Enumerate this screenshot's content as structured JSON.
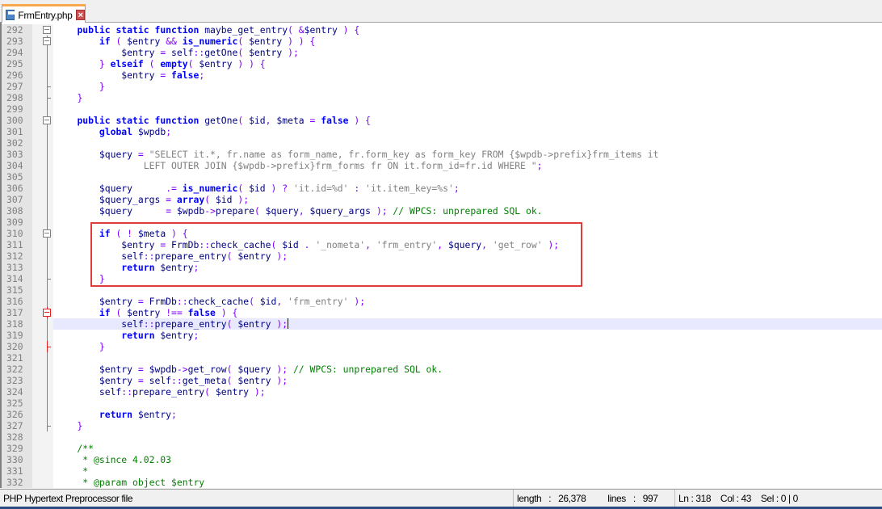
{
  "tab": {
    "filename": "FrmEntry.php",
    "close_icon": "close-icon",
    "file_icon": "save-icon"
  },
  "editor": {
    "current_line": 318,
    "lines": [
      {
        "n": 292,
        "text": "    public static function maybe_get_entry( &$entry ) {"
      },
      {
        "n": 293,
        "text": "        if ( $entry && is_numeric( $entry ) ) {"
      },
      {
        "n": 294,
        "text": "            $entry = self::getOne( $entry );"
      },
      {
        "n": 295,
        "text": "        } elseif ( empty( $entry ) ) {"
      },
      {
        "n": 296,
        "text": "            $entry = false;"
      },
      {
        "n": 297,
        "text": "        }"
      },
      {
        "n": 298,
        "text": "    }"
      },
      {
        "n": 299,
        "text": ""
      },
      {
        "n": 300,
        "text": "    public static function getOne( $id, $meta = false ) {"
      },
      {
        "n": 301,
        "text": "        global $wpdb;"
      },
      {
        "n": 302,
        "text": ""
      },
      {
        "n": 303,
        "text": "        $query = \"SELECT it.*, fr.name as form_name, fr.form_key as form_key FROM {$wpdb->prefix}frm_items it"
      },
      {
        "n": 304,
        "text": "                LEFT OUTER JOIN {$wpdb->prefix}frm_forms fr ON it.form_id=fr.id WHERE \";"
      },
      {
        "n": 305,
        "text": ""
      },
      {
        "n": 306,
        "text": "        $query      .= is_numeric( $id ) ? 'it.id=%d' : 'it.item_key=%s';"
      },
      {
        "n": 307,
        "text": "        $query_args = array( $id );"
      },
      {
        "n": 308,
        "text": "        $query      = $wpdb->prepare( $query, $query_args ); // WPCS: unprepared SQL ok."
      },
      {
        "n": 309,
        "text": ""
      },
      {
        "n": 310,
        "text": "        if ( ! $meta ) {"
      },
      {
        "n": 311,
        "text": "            $entry = FrmDb::check_cache( $id . '_nometa', 'frm_entry', $query, 'get_row' );"
      },
      {
        "n": 312,
        "text": "            self::prepare_entry( $entry );"
      },
      {
        "n": 313,
        "text": "            return $entry;"
      },
      {
        "n": 314,
        "text": "        }"
      },
      {
        "n": 315,
        "text": ""
      },
      {
        "n": 316,
        "text": "        $entry = FrmDb::check_cache( $id, 'frm_entry' );"
      },
      {
        "n": 317,
        "text": "        if ( $entry !== false ) {"
      },
      {
        "n": 318,
        "text": "            self::prepare_entry( $entry );"
      },
      {
        "n": 319,
        "text": "            return $entry;"
      },
      {
        "n": 320,
        "text": "        }"
      },
      {
        "n": 321,
        "text": ""
      },
      {
        "n": 322,
        "text": "        $entry = $wpdb->get_row( $query ); // WPCS: unprepared SQL ok."
      },
      {
        "n": 323,
        "text": "        $entry = self::get_meta( $entry );"
      },
      {
        "n": 324,
        "text": "        self::prepare_entry( $entry );"
      },
      {
        "n": 325,
        "text": ""
      },
      {
        "n": 326,
        "text": "        return $entry;"
      },
      {
        "n": 327,
        "text": "    }"
      },
      {
        "n": 328,
        "text": ""
      },
      {
        "n": 329,
        "text": "    /**"
      },
      {
        "n": 330,
        "text": "     * @since 4.02.03"
      },
      {
        "n": 331,
        "text": "     *"
      },
      {
        "n": 332,
        "text": "     * @param object $entry"
      }
    ],
    "folds": {
      "292": "open",
      "293": "open",
      "297": "end",
      "298": "end",
      "300": "open",
      "310": "open",
      "314": "end",
      "317": "open-current",
      "320": "end-current",
      "327": "end"
    },
    "highlight_color": "#e03c3c"
  },
  "status": {
    "file_type": "PHP Hypertext Preprocessor file",
    "length": "length : 26,378",
    "lines": "lines : 997",
    "ln": "Ln : 318",
    "col": "Col : 43",
    "sel": "Sel : 0 | 0"
  }
}
